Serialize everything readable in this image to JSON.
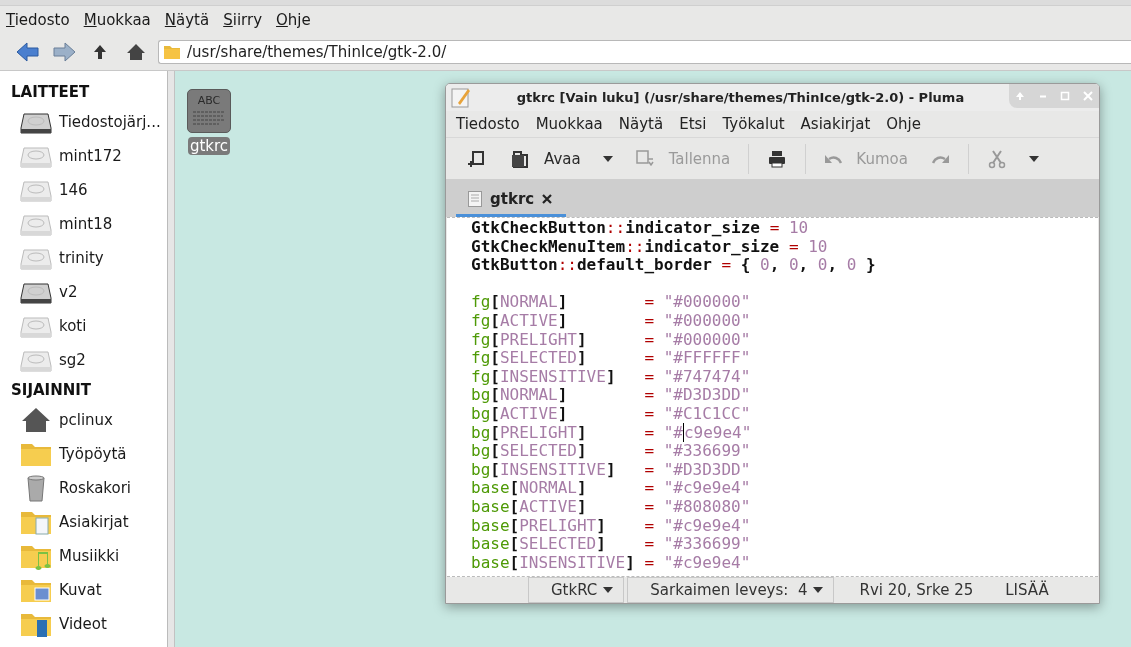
{
  "menu": [
    {
      "label": "Tiedosto",
      "mnemonic": true
    },
    {
      "label": "Muokkaa",
      "mnemonic": true
    },
    {
      "label": "Näytä",
      "mnemonic": true
    },
    {
      "label": "Siirry",
      "mnemonic": true
    },
    {
      "label": "Ohje",
      "mnemonic": true
    }
  ],
  "location": {
    "value": "/usr/share/themes/ThinIce/gtk-2.0/"
  },
  "sidebar": [
    {
      "heading": "LAITTEET",
      "items": [
        {
          "label": "Tiedostojärj...",
          "kind": "drive-dark"
        },
        {
          "label": "mint172",
          "kind": "drive"
        },
        {
          "label": "146",
          "kind": "drive"
        },
        {
          "label": "mint18",
          "kind": "drive"
        },
        {
          "label": "trinity",
          "kind": "drive"
        },
        {
          "label": "v2",
          "kind": "drive-dark"
        },
        {
          "label": "koti",
          "kind": "drive"
        },
        {
          "label": "sg2",
          "kind": "drive"
        }
      ]
    },
    {
      "heading": "SIJAINNIT",
      "items": [
        {
          "label": "pclinux",
          "kind": "home"
        },
        {
          "label": "Työpöytä",
          "kind": "folder"
        },
        {
          "label": "Roskakori",
          "kind": "trash"
        },
        {
          "label": "Asiakirjat",
          "kind": "documents"
        },
        {
          "label": "Musiikki",
          "kind": "music"
        },
        {
          "label": "Kuvat",
          "kind": "pictures"
        },
        {
          "label": "Videot",
          "kind": "videos"
        }
      ]
    }
  ],
  "files": [
    {
      "icon_text": "ABC",
      "name": "gtkrc",
      "selected": true
    }
  ],
  "editor": {
    "title": "gtkrc [Vain luku] (/usr/share/themes/ThinIce/gtk-2.0) - Pluma",
    "menu": [
      "Tiedosto",
      "Muokkaa",
      "Näytä",
      "Etsi",
      "Työkalut",
      "Asiakirjat",
      "Ohje"
    ],
    "toolbar": [
      {
        "kind": "new"
      },
      {
        "kind": "open",
        "label": "Avaa",
        "disabled": false
      },
      {
        "kind": "caret"
      },
      {
        "kind": "save",
        "label": "Tallenna",
        "disabled": true
      },
      {
        "kind": "separator"
      },
      {
        "kind": "print"
      },
      {
        "kind": "separator"
      },
      {
        "kind": "undo",
        "label": "Kumoa",
        "disabled": true
      },
      {
        "kind": "redo",
        "disabled": true
      },
      {
        "kind": "separator"
      },
      {
        "kind": "cut",
        "disabled": true
      },
      {
        "kind": "caret"
      }
    ],
    "tabs": [
      {
        "label": "gtkrc",
        "selected": true
      }
    ],
    "code": [
      {
        "tokens": [
          {
            "kind": "ident",
            "text": "GtkCheckButton"
          },
          {
            "kind": "op",
            "text": "::"
          },
          {
            "kind": "ident",
            "text": "indicator_size "
          },
          {
            "kind": "op",
            "text": "="
          },
          {
            "kind": "num",
            "text": " 10"
          }
        ]
      },
      {
        "tokens": [
          {
            "kind": "ident",
            "text": "GtkCheckMenuItem"
          },
          {
            "kind": "op",
            "text": "::"
          },
          {
            "kind": "ident",
            "text": "indicator_size "
          },
          {
            "kind": "op",
            "text": "="
          },
          {
            "kind": "num",
            "text": " 10"
          }
        ]
      },
      {
        "tokens": [
          {
            "kind": "ident",
            "text": "GtkButton"
          },
          {
            "kind": "op",
            "text": "::"
          },
          {
            "kind": "ident",
            "text": "default_border "
          },
          {
            "kind": "op",
            "text": "="
          },
          {
            "kind": "ident",
            "text": " { "
          },
          {
            "kind": "num",
            "text": "0"
          },
          {
            "kind": "ident",
            "text": ", "
          },
          {
            "kind": "num",
            "text": "0"
          },
          {
            "kind": "ident",
            "text": ", "
          },
          {
            "kind": "num",
            "text": "0"
          },
          {
            "kind": "ident",
            "text": ", "
          },
          {
            "kind": "num",
            "text": "0"
          },
          {
            "kind": "ident",
            "text": " }"
          }
        ]
      },
      {
        "gap_before": true,
        "tokens": [
          {
            "kind": "key",
            "text": "fg"
          },
          {
            "kind": "ident",
            "text": "["
          },
          {
            "kind": "state",
            "text": "NORMAL"
          },
          {
            "kind": "ident",
            "text": "]        "
          },
          {
            "kind": "op",
            "text": "="
          },
          {
            "kind": "str",
            "text": " \"#000000\""
          }
        ]
      },
      {
        "tokens": [
          {
            "kind": "key",
            "text": "fg"
          },
          {
            "kind": "ident",
            "text": "["
          },
          {
            "kind": "state",
            "text": "ACTIVE"
          },
          {
            "kind": "ident",
            "text": "]        "
          },
          {
            "kind": "op",
            "text": "="
          },
          {
            "kind": "str",
            "text": " \"#000000\""
          }
        ]
      },
      {
        "tokens": [
          {
            "kind": "key",
            "text": "fg"
          },
          {
            "kind": "ident",
            "text": "["
          },
          {
            "kind": "state",
            "text": "PRELIGHT"
          },
          {
            "kind": "ident",
            "text": "]      "
          },
          {
            "kind": "op",
            "text": "="
          },
          {
            "kind": "str",
            "text": " \"#000000\""
          }
        ]
      },
      {
        "tokens": [
          {
            "kind": "key",
            "text": "fg"
          },
          {
            "kind": "ident",
            "text": "["
          },
          {
            "kind": "state",
            "text": "SELECTED"
          },
          {
            "kind": "ident",
            "text": "]      "
          },
          {
            "kind": "op",
            "text": "="
          },
          {
            "kind": "str",
            "text": " \"#FFFFFF\""
          }
        ]
      },
      {
        "tokens": [
          {
            "kind": "key",
            "text": "fg"
          },
          {
            "kind": "ident",
            "text": "["
          },
          {
            "kind": "state",
            "text": "INSENSITIVE"
          },
          {
            "kind": "ident",
            "text": "]   "
          },
          {
            "kind": "op",
            "text": "="
          },
          {
            "kind": "str",
            "text": " \"#747474\""
          }
        ]
      },
      {
        "tokens": [
          {
            "kind": "key",
            "text": "bg"
          },
          {
            "kind": "ident",
            "text": "["
          },
          {
            "kind": "state",
            "text": "NORMAL"
          },
          {
            "kind": "ident",
            "text": "]        "
          },
          {
            "kind": "op",
            "text": "="
          },
          {
            "kind": "str",
            "text": " \"#D3D3DD\""
          }
        ]
      },
      {
        "tokens": [
          {
            "kind": "key",
            "text": "bg"
          },
          {
            "kind": "ident",
            "text": "["
          },
          {
            "kind": "state",
            "text": "ACTIVE"
          },
          {
            "kind": "ident",
            "text": "]        "
          },
          {
            "kind": "op",
            "text": "="
          },
          {
            "kind": "str",
            "text": " \"#C1C1CC\""
          }
        ]
      },
      {
        "tokens": [
          {
            "kind": "key",
            "text": "bg"
          },
          {
            "kind": "ident",
            "text": "["
          },
          {
            "kind": "state",
            "text": "PRELIGHT"
          },
          {
            "kind": "ident",
            "text": "]      "
          },
          {
            "kind": "op",
            "text": "="
          },
          {
            "kind": "str",
            "text": " \"#"
          },
          {
            "kind": "str",
            "text": "c9e9e4\"",
            "caret": true
          }
        ]
      },
      {
        "tokens": [
          {
            "kind": "key",
            "text": "bg"
          },
          {
            "kind": "ident",
            "text": "["
          },
          {
            "kind": "state",
            "text": "SELECTED"
          },
          {
            "kind": "ident",
            "text": "]      "
          },
          {
            "kind": "op",
            "text": "="
          },
          {
            "kind": "str",
            "text": " \"#336699\""
          }
        ]
      },
      {
        "tokens": [
          {
            "kind": "key",
            "text": "bg"
          },
          {
            "kind": "ident",
            "text": "["
          },
          {
            "kind": "state",
            "text": "INSENSITIVE"
          },
          {
            "kind": "ident",
            "text": "]   "
          },
          {
            "kind": "op",
            "text": "="
          },
          {
            "kind": "str",
            "text": " \"#D3D3DD\""
          }
        ]
      },
      {
        "tokens": [
          {
            "kind": "key",
            "text": "base"
          },
          {
            "kind": "ident",
            "text": "["
          },
          {
            "kind": "state",
            "text": "NORMAL"
          },
          {
            "kind": "ident",
            "text": "]      "
          },
          {
            "kind": "op",
            "text": "="
          },
          {
            "kind": "str",
            "text": " \"#c9e9e4\""
          }
        ]
      },
      {
        "tokens": [
          {
            "kind": "key",
            "text": "base"
          },
          {
            "kind": "ident",
            "text": "["
          },
          {
            "kind": "state",
            "text": "ACTIVE"
          },
          {
            "kind": "ident",
            "text": "]      "
          },
          {
            "kind": "op",
            "text": "="
          },
          {
            "kind": "str",
            "text": " \"#808080\""
          }
        ]
      },
      {
        "tokens": [
          {
            "kind": "key",
            "text": "base"
          },
          {
            "kind": "ident",
            "text": "["
          },
          {
            "kind": "state",
            "text": "PRELIGHT"
          },
          {
            "kind": "ident",
            "text": "]    "
          },
          {
            "kind": "op",
            "text": "="
          },
          {
            "kind": "str",
            "text": " \"#c9e9e4\""
          }
        ]
      },
      {
        "tokens": [
          {
            "kind": "key",
            "text": "base"
          },
          {
            "kind": "ident",
            "text": "["
          },
          {
            "kind": "state",
            "text": "SELECTED"
          },
          {
            "kind": "ident",
            "text": "]    "
          },
          {
            "kind": "op",
            "text": "="
          },
          {
            "kind": "str",
            "text": " \"#336699\""
          }
        ]
      },
      {
        "tokens": [
          {
            "kind": "key",
            "text": "base"
          },
          {
            "kind": "ident",
            "text": "["
          },
          {
            "kind": "state",
            "text": "INSENSITIVE"
          },
          {
            "kind": "ident",
            "text": "] "
          },
          {
            "kind": "op",
            "text": "="
          },
          {
            "kind": "str",
            "text": " \"#c9e9e4\""
          }
        ]
      }
    ],
    "status": [
      {
        "kind": "dropdown",
        "label": "GtkRC"
      },
      {
        "kind": "dropdown",
        "label": "Sarkaimen leveys:  4"
      },
      {
        "kind": "text",
        "label": "Rvi 20, Srke 25"
      },
      {
        "kind": "text",
        "label": "LISÄÄ"
      }
    ]
  }
}
